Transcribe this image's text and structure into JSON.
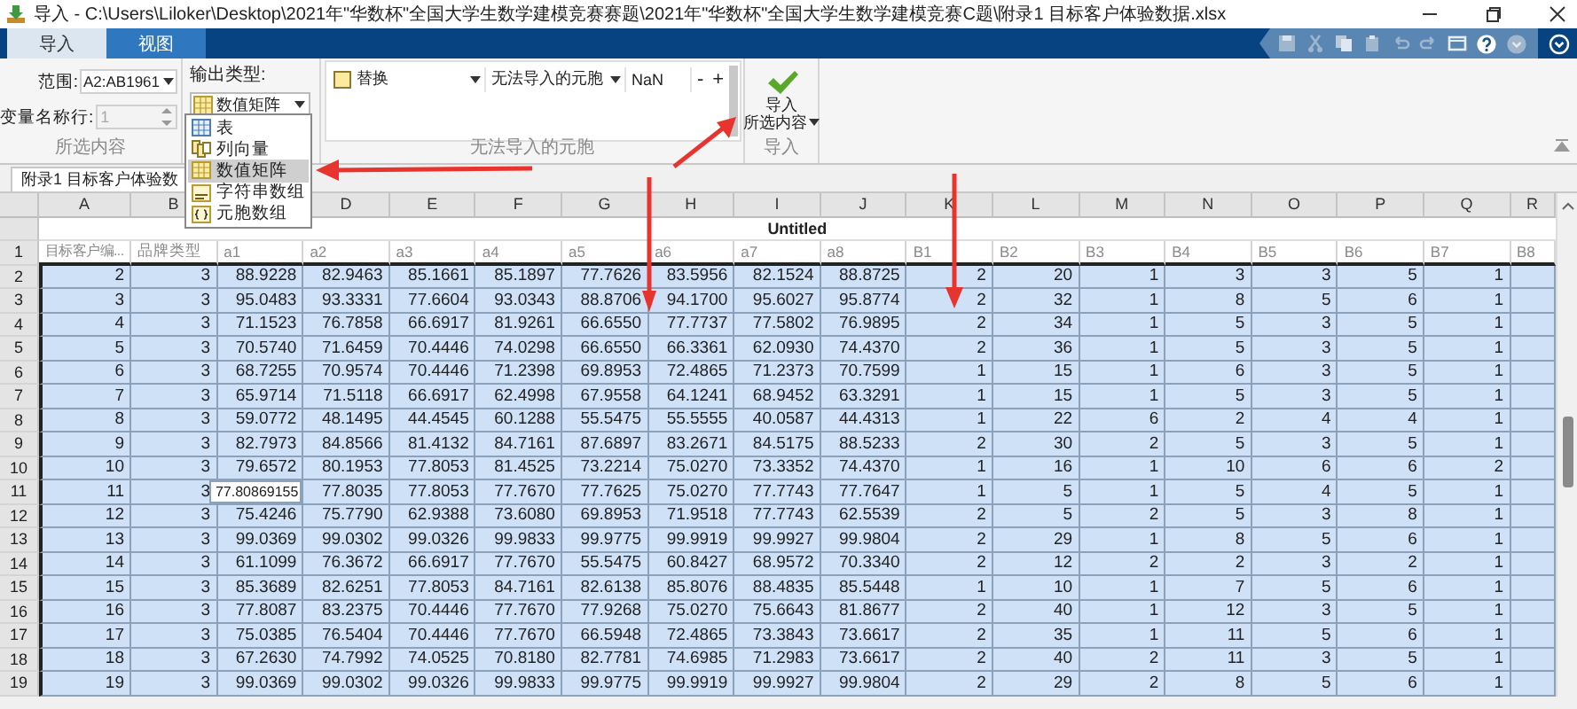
{
  "window": {
    "title": "导入 - C:\\Users\\Liloker\\Desktop\\2021年\"华数杯\"全国大学生数学建模竞赛赛题\\2021年\"华数杯\"全国大学生数学建模竞赛C题\\附录1 目标客户体验数据.xlsx"
  },
  "tabs": [
    {
      "label": "导入",
      "selected": true
    },
    {
      "label": "视图",
      "selected": false
    }
  ],
  "ribbon": {
    "selection": {
      "range_label": "范围:",
      "range_value": "A2:AB1961",
      "name_row_label": "变量名称行:",
      "name_row_value": "1",
      "name_row_disabled": true,
      "group_label": "所选内容"
    },
    "output_type": {
      "label": "输出类型:",
      "value": "数值矩阵",
      "menu": [
        {
          "label": "表",
          "kind": "table",
          "selected": false
        },
        {
          "label": "列向量",
          "kind": "column_vectors",
          "selected": false
        },
        {
          "label": "数值矩阵",
          "kind": "numeric_matrix",
          "selected": true
        },
        {
          "label": "字符串数组",
          "kind": "string_array",
          "selected": false
        },
        {
          "label": "元胞数组",
          "kind": "cell_array",
          "selected": false
        }
      ]
    },
    "unimportable": {
      "rule": "替换",
      "target": "无法导入的元胞",
      "value": "NaN",
      "remove": "-",
      "add": "+",
      "group_label": "无法导入的元胞"
    },
    "import": {
      "label": "导入",
      "sub_label": "所选内容",
      "group_label": "导入"
    }
  },
  "document_tab": {
    "label": "附录1 目标客户体验数"
  },
  "table": {
    "title": "Untitled",
    "columns": [
      "A",
      "B",
      null,
      "D",
      "E",
      "F",
      "G",
      "H",
      "I",
      "J",
      "K",
      "L",
      "M",
      "N",
      "O",
      "P",
      "Q",
      "R"
    ],
    "header_row": {
      "number": "1",
      "cells": [
        "目标客户编...",
        "品牌类型",
        "a1",
        "a2",
        "a3",
        "a4",
        "a5",
        "a6",
        "a7",
        "a8",
        "B1",
        "B2",
        "B3",
        "B4",
        "B5",
        "B6",
        "B7",
        "B8"
      ]
    },
    "rows": [
      {
        "number": "2",
        "cells": [
          "2",
          "3",
          "88.9228",
          "82.9463",
          "85.1661",
          "85.1897",
          "77.7626",
          "83.5956",
          "82.1524",
          "88.8725",
          "2",
          "20",
          "1",
          "3",
          "3",
          "5",
          "1"
        ]
      },
      {
        "number": "3",
        "cells": [
          "3",
          "3",
          "95.0483",
          "93.3331",
          "77.6604",
          "93.0343",
          "88.8706",
          "94.1700",
          "95.6027",
          "95.8774",
          "2",
          "32",
          "1",
          "8",
          "5",
          "6",
          "1"
        ]
      },
      {
        "number": "4",
        "cells": [
          "4",
          "3",
          "71.1523",
          "76.7858",
          "66.6917",
          "81.9261",
          "66.6550",
          "77.7737",
          "77.5802",
          "76.9895",
          "2",
          "34",
          "1",
          "5",
          "3",
          "5",
          "1"
        ]
      },
      {
        "number": "5",
        "cells": [
          "5",
          "3",
          "70.5740",
          "71.6459",
          "70.4446",
          "74.0298",
          "66.6550",
          "66.3361",
          "62.0930",
          "74.4370",
          "2",
          "36",
          "1",
          "5",
          "3",
          "5",
          "1"
        ]
      },
      {
        "number": "6",
        "cells": [
          "6",
          "3",
          "68.7255",
          "70.9574",
          "70.4446",
          "71.2398",
          "69.8953",
          "72.4865",
          "71.2373",
          "70.7599",
          "1",
          "15",
          "1",
          "6",
          "3",
          "5",
          "1"
        ]
      },
      {
        "number": "7",
        "cells": [
          "7",
          "3",
          "65.9714",
          "71.5118",
          "66.6917",
          "62.4998",
          "67.9558",
          "64.1241",
          "68.9452",
          "63.3291",
          "1",
          "15",
          "1",
          "5",
          "3",
          "5",
          "1"
        ]
      },
      {
        "number": "8",
        "cells": [
          "8",
          "3",
          "59.0772",
          "48.1495",
          "44.4545",
          "60.1288",
          "55.5475",
          "55.5555",
          "40.0587",
          "44.4313",
          "1",
          "22",
          "6",
          "2",
          "4",
          "4",
          "1"
        ]
      },
      {
        "number": "9",
        "cells": [
          "9",
          "3",
          "82.7973",
          "84.8566",
          "81.4132",
          "84.7161",
          "87.6897",
          "83.2671",
          "84.5175",
          "88.5233",
          "2",
          "30",
          "2",
          "5",
          "3",
          "5",
          "1"
        ]
      },
      {
        "number": "10",
        "cells": [
          "10",
          "3",
          "79.6572",
          "80.1953",
          "77.8053",
          "81.4525",
          "73.2214",
          "75.0270",
          "73.3352",
          "74.4370",
          "1",
          "16",
          "1",
          "10",
          "6",
          "6",
          "2"
        ]
      },
      {
        "number": "11",
        "cells": [
          "11",
          "3",
          {
            "text": "77.80869155",
            "editing": true
          },
          "77.8035",
          "77.8053",
          "77.7670",
          "77.7625",
          "75.0270",
          "77.7743",
          "77.7647",
          "1",
          "5",
          "1",
          "5",
          "4",
          "5",
          "1"
        ]
      },
      {
        "number": "12",
        "cells": [
          "12",
          "3",
          "75.4246",
          "75.7790",
          "62.9388",
          "73.6080",
          "69.8953",
          "71.9518",
          "77.7743",
          "62.5539",
          "2",
          "5",
          "2",
          "5",
          "3",
          "8",
          "1"
        ]
      },
      {
        "number": "13",
        "cells": [
          "13",
          "3",
          "99.0369",
          "99.0302",
          "99.0326",
          "99.9833",
          "99.9775",
          "99.9919",
          "99.9927",
          "99.9804",
          "2",
          "29",
          "1",
          "8",
          "5",
          "6",
          "1"
        ]
      },
      {
        "number": "14",
        "cells": [
          "14",
          "3",
          "61.1099",
          "76.3672",
          "66.6917",
          "77.7670",
          "55.5475",
          "60.8427",
          "68.9572",
          "70.3340",
          "2",
          "12",
          "2",
          "2",
          "3",
          "2",
          "1"
        ]
      },
      {
        "number": "15",
        "cells": [
          "15",
          "3",
          "85.3689",
          "82.6251",
          "77.8053",
          "84.7161",
          "82.6138",
          "85.8076",
          "88.4835",
          "85.5448",
          "1",
          "10",
          "1",
          "7",
          "5",
          "6",
          "1"
        ]
      },
      {
        "number": "16",
        "cells": [
          "16",
          "3",
          "77.8087",
          "83.2375",
          "70.4446",
          "77.7670",
          "77.9268",
          "75.0270",
          "75.6643",
          "81.8677",
          "2",
          "40",
          "1",
          "12",
          "3",
          "5",
          "1"
        ]
      },
      {
        "number": "17",
        "cells": [
          "17",
          "3",
          "75.0385",
          "76.5404",
          "70.4446",
          "77.7670",
          "66.5948",
          "72.4865",
          "73.3843",
          "73.6617",
          "2",
          "35",
          "1",
          "11",
          "5",
          "6",
          "1"
        ]
      },
      {
        "number": "18",
        "cells": [
          "18",
          "3",
          "67.2630",
          "74.7992",
          "74.0525",
          "70.8180",
          "82.7781",
          "74.6985",
          "71.2983",
          "73.6617",
          "2",
          "40",
          "2",
          "11",
          "3",
          "5",
          "1"
        ]
      },
      {
        "number": "19",
        "cells": [
          "19",
          "3",
          "99.0369",
          "99.0302",
          "99.0326",
          "99.9833",
          "99.9775",
          "99.9919",
          "99.9927",
          "99.9804",
          "2",
          "29",
          "2",
          "8",
          "5",
          "6",
          "1"
        ]
      }
    ]
  }
}
